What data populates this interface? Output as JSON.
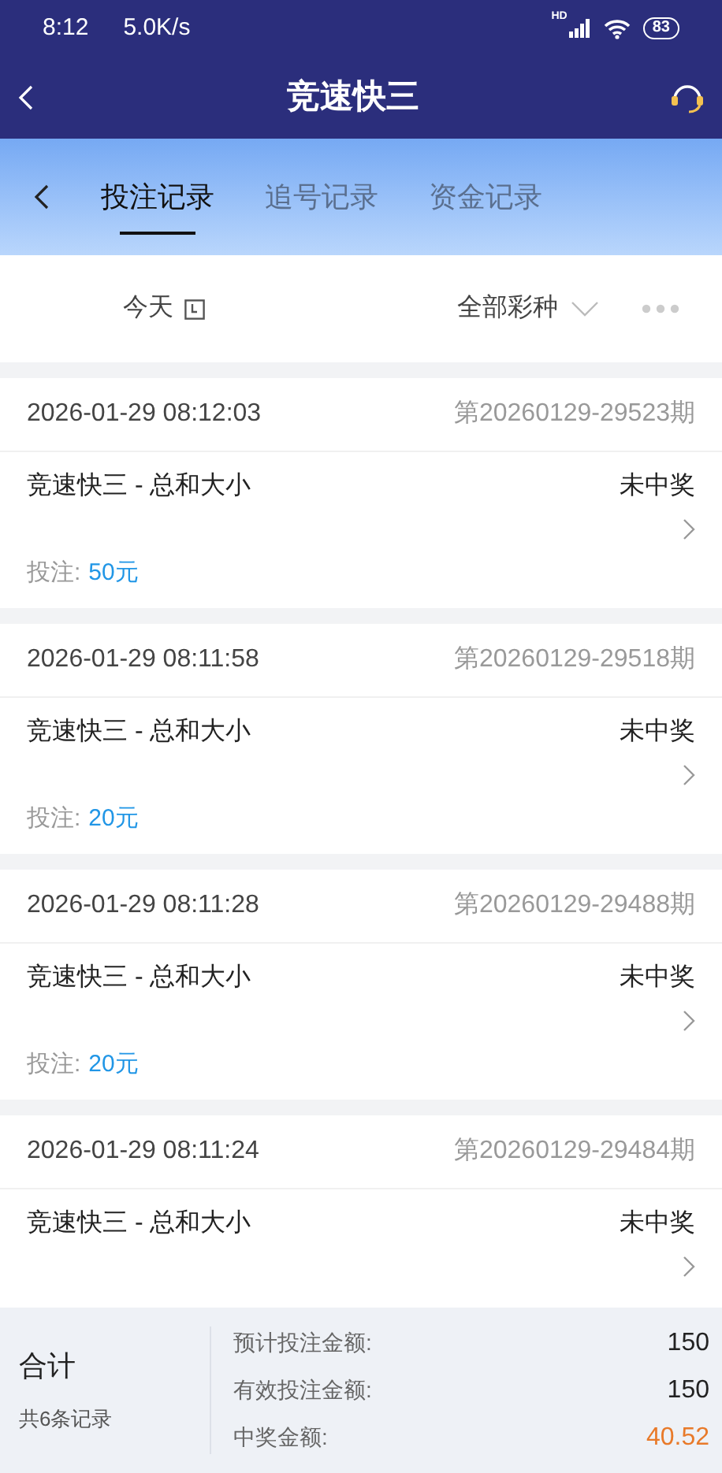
{
  "status_bar": {
    "time": "8:12",
    "speed": "5.0K/s",
    "network_label": "HD",
    "battery": "83"
  },
  "header": {
    "title": "竞速快三"
  },
  "tabs": [
    {
      "label": "投注记录",
      "selected": true
    },
    {
      "label": "追号记录",
      "selected": false
    },
    {
      "label": "资金记录",
      "selected": false
    }
  ],
  "filters": {
    "date": "今天",
    "lottery": "全部彩种"
  },
  "records": [
    {
      "time": "2026-01-29 08:12:03",
      "issue": "第20260129-29523期",
      "title": "竞速快三 - 总和大小",
      "status": "未中奖",
      "bet_label": "投注:",
      "amount": "50元"
    },
    {
      "time": "2026-01-29 08:11:58",
      "issue": "第20260129-29518期",
      "title": "竞速快三 - 总和大小",
      "status": "未中奖",
      "bet_label": "投注:",
      "amount": "20元"
    },
    {
      "time": "2026-01-29 08:11:28",
      "issue": "第20260129-29488期",
      "title": "竞速快三 - 总和大小",
      "status": "未中奖",
      "bet_label": "投注:",
      "amount": "20元"
    },
    {
      "time": "2026-01-29 08:11:24",
      "issue": "第20260129-29484期",
      "title": "竞速快三 - 总和大小",
      "status": "未中奖"
    }
  ],
  "summary": {
    "title": "合计",
    "count": "共6条记录",
    "rows": [
      {
        "label": "预计投注金额:",
        "value": "150",
        "kind": "plain"
      },
      {
        "label": "有效投注金额:",
        "value": "150",
        "kind": "plain"
      },
      {
        "label": "中奖金额:",
        "value": "40.52",
        "kind": "highlight"
      }
    ]
  }
}
